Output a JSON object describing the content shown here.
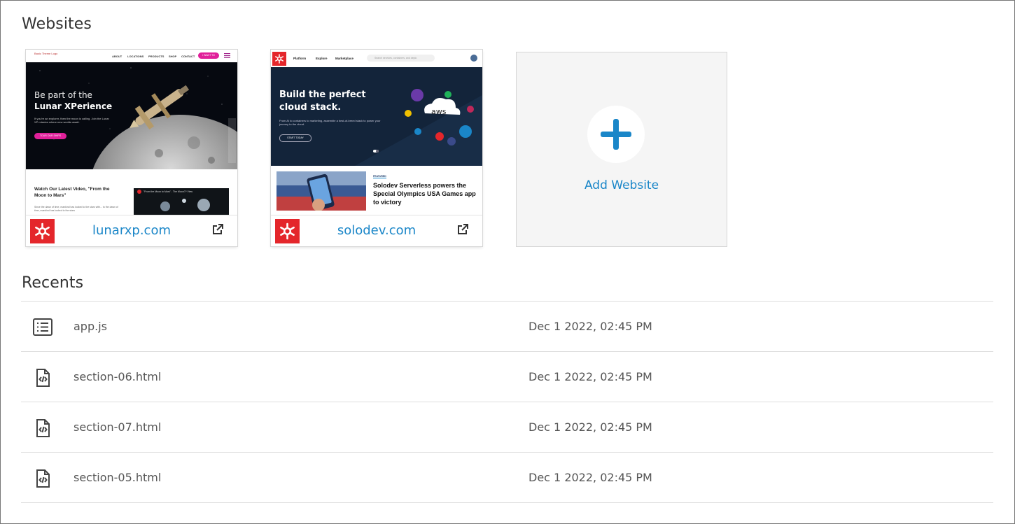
{
  "websites": {
    "title": "Websites",
    "sites": [
      {
        "domain": "lunarxp.com",
        "thumb": {
          "logo_alt": "Basic Theme Logo",
          "nav": [
            "ABOUT",
            "LOCATIONS",
            "PRODUCTS",
            "SHOP",
            "CONTACT"
          ],
          "nav_button": "I WANT TO",
          "hero_line1": "Be part of the",
          "hero_line2": "Lunar XPerience",
          "hero_body": "If you're an explorer, then the moon is calling. Join the Lunar XP mission where new worlds await.",
          "hero_button": "TOUR OUR SHIPS",
          "video_heading": "Watch Our Latest Video, \"From the Moon to Mars\"",
          "video_body": "Since the dawn of time, mankind has looked to the stars with... to the dawn of time, mankind has looked to the stars",
          "video_caption": "\"From the Moon to Mars\" - The Moon?? View"
        }
      },
      {
        "domain": "solodev.com",
        "thumb": {
          "nav": [
            "Platform",
            "Explore",
            "Marketplace"
          ],
          "search_placeholder": "Search services, containers, and deplo",
          "hero_line1": "Build the perfect",
          "hero_line2": "cloud stack.",
          "hero_body": "From AI to containers to marketing, assemble a best-of-breed stack to power your journey to the cloud.",
          "hero_button": "START TODAY",
          "cloud_label": "aws",
          "featured_label": "FEATURED",
          "featured_title": "Solodev Serverless powers the Special Olympics USA Games app to victory"
        }
      }
    ],
    "add_label": "Add Website"
  },
  "recents": {
    "title": "Recents",
    "items": [
      {
        "name": "app.js",
        "date": "Dec 1 2022, 02:45 PM",
        "icon": "list-file-icon"
      },
      {
        "name": "section-06.html",
        "date": "Dec 1 2022, 02:45 PM",
        "icon": "code-file-icon"
      },
      {
        "name": "section-07.html",
        "date": "Dec 1 2022, 02:45 PM",
        "icon": "code-file-icon"
      },
      {
        "name": "section-05.html",
        "date": "Dec 1 2022, 02:45 PM",
        "icon": "code-file-icon"
      }
    ]
  },
  "colors": {
    "accent": "#1a86c8",
    "logo_red": "#e4262b",
    "magenta": "#e0209a"
  }
}
